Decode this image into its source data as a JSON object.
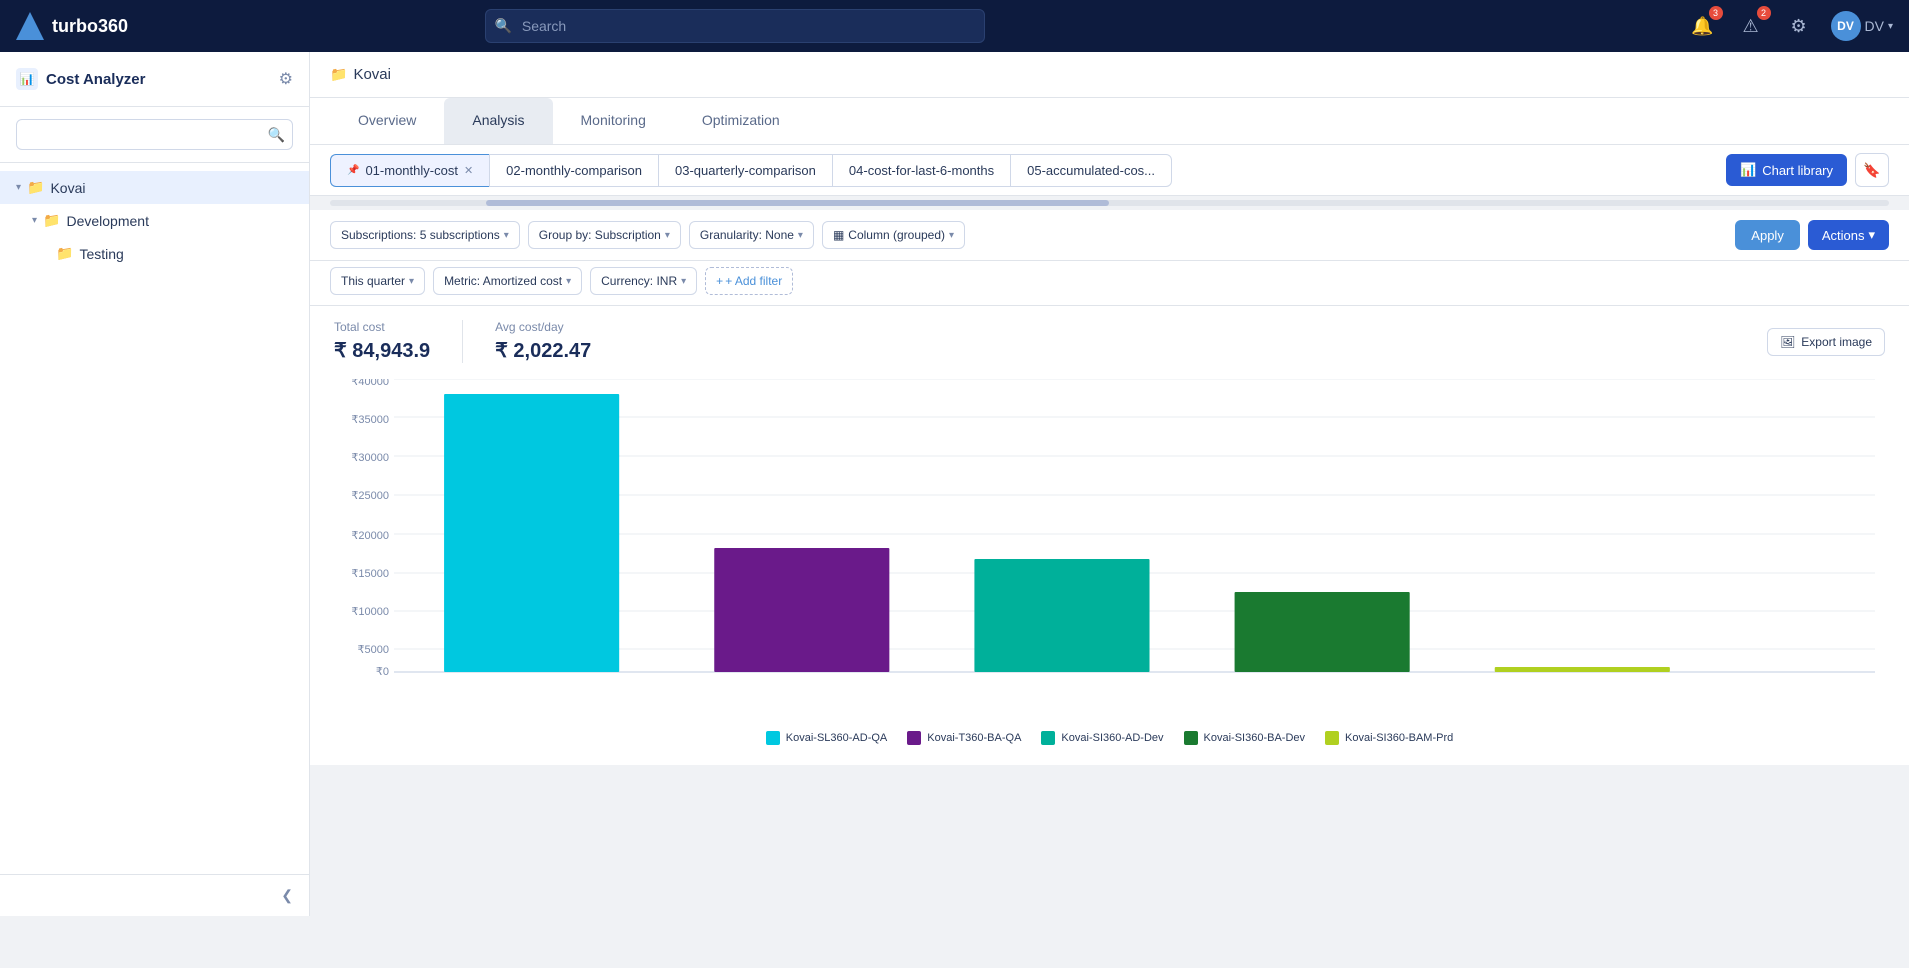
{
  "app": {
    "name": "turbo360",
    "logo_alt": "turbo360 logo"
  },
  "nav": {
    "search_placeholder": "Search",
    "notifications_badge": "3",
    "alerts_badge": "2",
    "user_initials": "DV",
    "user_label": "DV"
  },
  "sidebar": {
    "title": "Cost Analyzer",
    "search_placeholder": "",
    "tree": [
      {
        "label": "Kovai",
        "type": "folder",
        "level": 0,
        "expanded": true,
        "active": true
      },
      {
        "label": "Development",
        "type": "folder",
        "level": 1,
        "expanded": true,
        "active": false
      },
      {
        "label": "Testing",
        "type": "folder",
        "level": 2,
        "expanded": false,
        "active": false
      }
    ],
    "collapse_icon": "❮"
  },
  "page": {
    "breadcrumb": "Kovai"
  },
  "tabs": [
    {
      "label": "Overview",
      "active": false
    },
    {
      "label": "Analysis",
      "active": true
    },
    {
      "label": "Monitoring",
      "active": false
    },
    {
      "label": "Optimization",
      "active": false
    }
  ],
  "view_tabs": [
    {
      "label": "01-monthly-cost",
      "active": true,
      "pinned": true,
      "closable": true
    },
    {
      "label": "02-monthly-comparison",
      "active": false
    },
    {
      "label": "03-quarterly-comparison",
      "active": false
    },
    {
      "label": "04-cost-for-last-6-months",
      "active": false
    },
    {
      "label": "05-accumulated-cos...",
      "active": false
    }
  ],
  "toolbar": {
    "chart_library_label": "Chart library",
    "bookmark_icon": "🔖",
    "apply_label": "Apply",
    "actions_label": "Actions",
    "actions_arrow": "▾"
  },
  "filters": [
    {
      "label": "Subscriptions: 5 subscriptions",
      "arrow": "▾"
    },
    {
      "label": "Group by: Subscription",
      "arrow": "▾"
    },
    {
      "label": "Granularity: None",
      "arrow": "▾"
    },
    {
      "label": "Column (grouped)",
      "arrow": "▾"
    }
  ],
  "filters_row2": [
    {
      "label": "This quarter",
      "arrow": "▾"
    },
    {
      "label": "Metric: Amortized cost",
      "arrow": "▾"
    },
    {
      "label": "Currency: INR",
      "arrow": "▾"
    }
  ],
  "add_filter_label": "+ Add filter",
  "stats": {
    "total_cost_label": "Total cost",
    "total_cost_value": "₹ 84,943.9",
    "avg_cost_label": "Avg cost/day",
    "avg_cost_value": "₹ 2,022.47"
  },
  "export": {
    "label": "Export image",
    "icon": "🖼"
  },
  "chart": {
    "y_labels": [
      "₹0",
      "₹5000",
      "₹10000",
      "₹15000",
      "₹20000",
      "₹25000",
      "₹30000",
      "₹35000",
      "₹40000"
    ],
    "bars": [
      {
        "name": "Kovai-SL360-AD-QA",
        "color": "#00c8e0",
        "value": 38000,
        "pct": 95
      },
      {
        "name": "Kovai-T360-BA-QA",
        "color": "#6a1a8a",
        "value": 17000,
        "pct": 42
      },
      {
        "name": "Kovai-SI360-AD-Dev",
        "color": "#00b09a",
        "value": 15500,
        "pct": 38
      },
      {
        "name": "Kovai-SI360-BA-Dev",
        "color": "#1a7a30",
        "value": 11000,
        "pct": 27
      },
      {
        "name": "Kovai-SI360-BAM-Prd",
        "color": "#b0d020",
        "value": 800,
        "pct": 2
      }
    ],
    "max_value": 40000,
    "currency_symbol": "₹"
  }
}
